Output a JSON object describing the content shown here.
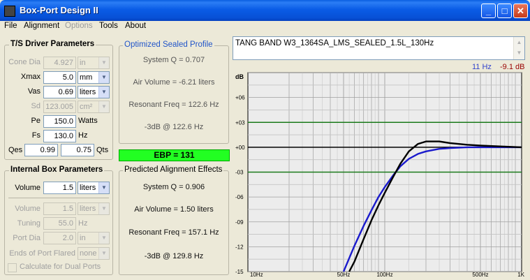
{
  "window": {
    "title": "Box-Port Design II"
  },
  "menu": {
    "items": [
      "File",
      "Alignment",
      "Options",
      "Tools",
      "About"
    ],
    "disabled": [
      "Options"
    ]
  },
  "ts_params": {
    "title": "T/S Driver Parameters",
    "cone_dia": {
      "label": "Cone Dia",
      "value": "4.927",
      "unit": "in"
    },
    "xmax": {
      "label": "Xmax",
      "value": "5.0",
      "unit": "mm"
    },
    "vas": {
      "label": "Vas",
      "value": "0.69",
      "unit": "liters"
    },
    "sd": {
      "label": "Sd",
      "value": "123.005",
      "unit": "cm²"
    },
    "pe": {
      "label": "Pe",
      "value": "150.0",
      "unit": "Watts"
    },
    "fs": {
      "label": "Fs",
      "value": "130.0",
      "unit": "Hz"
    },
    "qes": {
      "label": "Qes",
      "value": "0.99"
    },
    "qts": {
      "label": "Qts",
      "value": "0.75"
    }
  },
  "box_params": {
    "title": "Internal Box Parameters",
    "volume": {
      "label": "Volume",
      "value": "1.5",
      "unit": "liters"
    },
    "port_volume": {
      "label": "Volume",
      "value": "1.5",
      "unit": "liters"
    },
    "tuning": {
      "label": "Tuning",
      "value": "55.0",
      "unit": "Hz"
    },
    "port_dia": {
      "label": "Port Dia",
      "value": "2.0",
      "unit": "in"
    },
    "ends_flared": {
      "label": "Ends of Port Flared",
      "value": "none"
    },
    "dual_ports": {
      "label": "Calculate for Dual Ports"
    }
  },
  "optimized": {
    "title": "Optimized Sealed Profile",
    "system_q": "System Q = 0.707",
    "air_volume": "Air Volume = -6.21 liters",
    "resonant_freq": "Resonant Freq = 122.6 Hz",
    "f3": "-3dB @ 122.6 Hz"
  },
  "ebp": "EBP = 131",
  "predicted": {
    "title": "Predicted Alignment Effects",
    "system_q": "System Q = 0.906",
    "air_volume": "Air Volume = 1.50 liters",
    "resonant_freq": "Resonant Freq = 157.1 Hz",
    "f3": "-3dB @ 129.8 Hz"
  },
  "comment": "TANG BAND W3_1364SA_LMS_SEALED_1.5L_130Hz",
  "cursor_readout": {
    "freq": "11 Hz",
    "level": "-9.1 dB"
  },
  "colors": {
    "optimized_curve": "#1a1acc",
    "predicted_curve": "#000000",
    "ref_lines": "#1a7a1a",
    "readout_freq": "#3344cc",
    "readout_level": "#990000"
  },
  "chart_data": {
    "type": "line",
    "x_scale": "log",
    "xlim": [
      10,
      1000
    ],
    "ylim": [
      -15,
      9
    ],
    "ylabel": "dB",
    "y_ticks": [
      "+06",
      "+03",
      "+00",
      "-03",
      "-06",
      "-09",
      "-12",
      "-15"
    ],
    "x_ticks": [
      "10Hz",
      "50Hz",
      "100Hz",
      "500Hz",
      "1K"
    ],
    "reference_lines": [
      3,
      -3
    ],
    "series": [
      {
        "color": "blue",
        "x": [
          50,
          60,
          70,
          80,
          90,
          100,
          115,
          130,
          150,
          175,
          200,
          250,
          300,
          400,
          500,
          700,
          1000
        ],
        "y": [
          -15,
          -11.9,
          -9.5,
          -7.6,
          -6.0,
          -4.8,
          -3.4,
          -2.3,
          -1.4,
          -0.8,
          -0.5,
          -0.2,
          -0.1,
          0.0,
          0.0,
          0.0,
          0.0
        ]
      },
      {
        "color": "black",
        "x": [
          55,
          60,
          70,
          80,
          90,
          100,
          115,
          130,
          150,
          175,
          200,
          250,
          300,
          400,
          500,
          700,
          1000
        ],
        "y": [
          -15,
          -13.8,
          -11.1,
          -8.8,
          -7.0,
          -5.5,
          -3.6,
          -2.0,
          -0.5,
          0.4,
          0.7,
          0.7,
          0.5,
          0.3,
          0.2,
          0.1,
          0.0
        ]
      }
    ]
  }
}
